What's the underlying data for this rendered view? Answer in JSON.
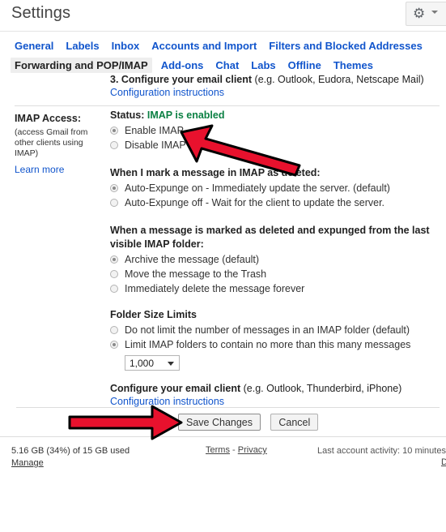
{
  "header": {
    "title": "Settings",
    "gear_icon": "gear-icon",
    "gear_caret_icon": "chevron-down-icon"
  },
  "tabs": {
    "row1": [
      {
        "label": "General",
        "active": false
      },
      {
        "label": "Labels",
        "active": false
      },
      {
        "label": "Inbox",
        "active": false
      },
      {
        "label": "Accounts and Import",
        "active": false
      },
      {
        "label": "Filters and Blocked Addresses",
        "active": false
      }
    ],
    "row2": [
      {
        "label": "Forwarding and POP/IMAP",
        "active": true
      },
      {
        "label": "Add-ons",
        "active": false
      },
      {
        "label": "Chat",
        "active": false
      },
      {
        "label": "Labs",
        "active": false
      },
      {
        "label": "Offline",
        "active": false
      },
      {
        "label": "Themes",
        "active": false
      }
    ]
  },
  "section_pop": {
    "heading_bold": "3. Configure your email client",
    "heading_plain": "(e.g. Outlook, Eudora, Netscape Mail)",
    "config_link": "Configuration instructions"
  },
  "imap": {
    "label_title": "IMAP Access:",
    "label_sub": "(access Gmail from other clients using IMAP)",
    "learn_more": "Learn more",
    "status_label": "Status:",
    "status_value": "IMAP is enabled",
    "status_color": "#0b8043",
    "enable_options": [
      {
        "label": "Enable IMAP",
        "checked": true
      },
      {
        "label": "Disable IMAP",
        "checked": false
      }
    ],
    "expunge_title": "When I mark a message in IMAP as deleted:",
    "expunge_options": [
      {
        "label": "Auto-Expunge on - Immediately update the server. (default)",
        "checked": true
      },
      {
        "label": "Auto-Expunge off - Wait for the client to update the server.",
        "checked": false
      }
    ],
    "folder_title_line1": "When a message is marked as deleted and expunged from the last",
    "folder_title_line2": "visible IMAP folder:",
    "folder_options": [
      {
        "label": "Archive the message (default)",
        "checked": true
      },
      {
        "label": "Move the message to the Trash",
        "checked": false
      },
      {
        "label": "Immediately delete the message forever",
        "checked": false
      }
    ],
    "size_title": "Folder Size Limits",
    "size_options": [
      {
        "label": "Do not limit the number of messages in an IMAP folder (default)",
        "checked": false
      },
      {
        "label": "Limit IMAP folders to contain no more than this many messages",
        "checked": true
      }
    ],
    "limit_value": "1,000",
    "limit_caret_icon": "chevron-down-icon",
    "configure_bold": "Configure your email client",
    "configure_plain": "(e.g. Outlook, Thunderbird, iPhone)",
    "configure_link": "Configuration instructions"
  },
  "actions": {
    "save_label": "Save Changes",
    "cancel_label": "Cancel"
  },
  "footer": {
    "storage_used": "5.16 GB (34%) of 15 GB used",
    "storage_used_prefix": "5.16",
    "storage_used_mid": " GB (34%) of ",
    "storage_used_suffix": "15 GB",
    "storage_used_tail": " used",
    "manage": "Manage",
    "terms": "Terms",
    "terms_sep": "-",
    "privacy": "Privacy",
    "last_activity": "Last account activity: 10 minutes",
    "details": "De"
  },
  "annotations": {
    "arrow_color": "#e8112d",
    "arrow_outline": "#000000",
    "arrow1_target": "Enable IMAP radio button",
    "arrow2_target": "Save Changes button"
  }
}
